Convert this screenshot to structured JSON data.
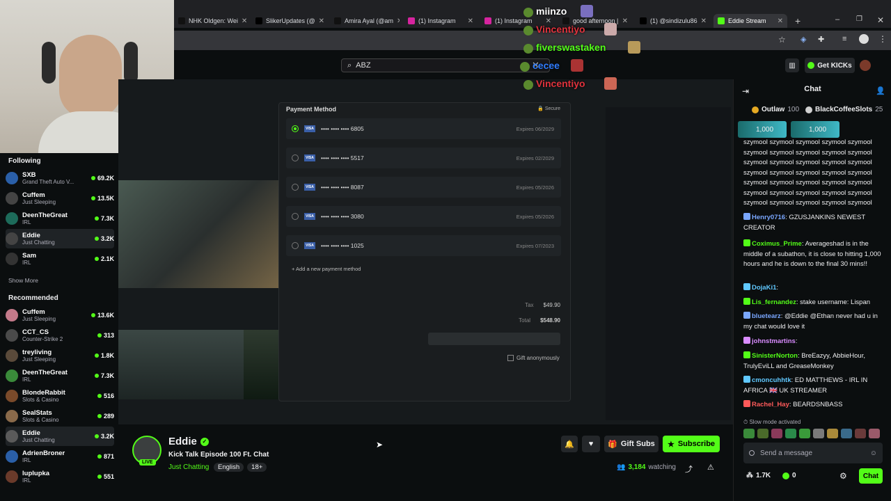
{
  "browser": {
    "tabs": [
      {
        "title": "NHK Oldgen: Wei",
        "icon": "tiktok-icon"
      },
      {
        "title": "SlikerUpdates (@",
        "icon": "x-icon"
      },
      {
        "title": "Amira Ayal (@am",
        "icon": "tiktok-icon"
      },
      {
        "title": "(1) Instagram",
        "icon": "instagram-icon"
      },
      {
        "title": "(1) Instagram",
        "icon": "instagram-icon"
      },
      {
        "title": "good afternoon |",
        "icon": "tiktok-icon"
      },
      {
        "title": "(1) @sindizulu86",
        "icon": "x-icon"
      },
      {
        "title": "Eddie Stream",
        "icon": "kick-icon"
      }
    ]
  },
  "site": {
    "search_value": "ABZ",
    "get_kicks": "Get KICKs"
  },
  "overlay_chat": [
    {
      "name": "miinzo",
      "color": "#ffffff"
    },
    {
      "name": "Vincentiyo",
      "color": "#e0323c"
    },
    {
      "name": "fiverswastaken",
      "color": "#53fc18"
    },
    {
      "name": "cecee",
      "color": "#2f7cff"
    },
    {
      "name": "Vincentiyo",
      "color": "#e0323c"
    }
  ],
  "sidebar": {
    "following_title": "Following",
    "following": [
      {
        "name": "SXB",
        "category": "Grand Theft Auto V...",
        "viewers": "69.2K"
      },
      {
        "name": "Cuffem",
        "category": "Just Sleeping",
        "viewers": "13.5K"
      },
      {
        "name": "DeenTheGreat",
        "category": "IRL",
        "viewers": "7.3K"
      },
      {
        "name": "Eddie",
        "category": "Just Chatting",
        "viewers": "3.2K"
      },
      {
        "name": "Sam",
        "category": "IRL",
        "viewers": "2.1K"
      }
    ],
    "show_more": "Show More",
    "recommended_title": "Recommended",
    "recommended": [
      {
        "name": "Cuffem",
        "category": "Just Sleeping",
        "viewers": "13.6K"
      },
      {
        "name": "CCT_CS",
        "category": "Counter-Strike 2",
        "viewers": "313"
      },
      {
        "name": "treyliving",
        "category": "Just Sleeping",
        "viewers": "1.8K"
      },
      {
        "name": "DeenTheGreat",
        "category": "IRL",
        "viewers": "7.3K"
      },
      {
        "name": "BlondeRabbit",
        "category": "Slots & Casino",
        "viewers": "516"
      },
      {
        "name": "SealStats",
        "category": "Slots & Casino",
        "viewers": "289"
      },
      {
        "name": "Eddie",
        "category": "Just Chatting",
        "viewers": "3.2K"
      },
      {
        "name": "AdrienBroner",
        "category": "IRL",
        "viewers": "871"
      },
      {
        "name": "luplupka",
        "category": "IRL",
        "viewers": "551"
      }
    ]
  },
  "payment": {
    "title": "Payment Method",
    "secure": "Secure",
    "cards": [
      {
        "mask": "•••• •••• •••• 6805",
        "expires": "Expires  06/2029",
        "selected": true
      },
      {
        "mask": "•••• •••• •••• 5517",
        "expires": "Expires  02/2029",
        "selected": false
      },
      {
        "mask": "•••• •••• •••• 8087",
        "expires": "Expires  05/2026",
        "selected": false
      },
      {
        "mask": "•••• •••• •••• 3080",
        "expires": "Expires  05/2026",
        "selected": false
      },
      {
        "mask": "•••• •••• •••• 1025",
        "expires": "Expires  07/2023",
        "selected": false
      }
    ],
    "add_new": "+ Add a new payment method",
    "tax_label": "Tax",
    "tax_value": "$49.90",
    "total_label": "Total",
    "total_value": "$548.90",
    "gift_anon": "Gift anonymously"
  },
  "stream": {
    "streamer": "Eddie",
    "title": "Kick Talk Episode 100 Ft. Chat",
    "category": "Just Chatting",
    "tags": [
      "English",
      "18+"
    ],
    "live_label": "LIVE",
    "viewers": "3,184",
    "watching_label": "watching",
    "gift_subs": "Gift Subs",
    "subscribe": "Subscribe"
  },
  "chat": {
    "title": "Chat",
    "leaderboard": [
      {
        "name": "Outlaw",
        "value": "100"
      },
      {
        "name": "BlackCoffeeSlots",
        "value": "25"
      }
    ],
    "pinned": [
      {
        "value": "1,000"
      },
      {
        "value": "1,000"
      }
    ],
    "spam_text": "szymool szymool szymool szymool szymool szymool szymool szymool szymool szymool szymool szymool szymool szymool szymool szymool szymool szymool szymool szymool szymool szymool szymool szymool szymool szymool szymool szymool szymool szymool szymool szymool szymool szymool szymool",
    "messages": [
      {
        "user": "Henry0716",
        "color": "#7aa7ff",
        "text": "GZUSJANKINS NEWEST CREATOR"
      },
      {
        "user": "Coximus_Prime",
        "color": "#53fc18",
        "text": "Averageshad is in the middle of a subathon, it is close to hitting 1,000 hours and he is down to the final 30 mins!!"
      },
      {
        "user": "DojaKi1",
        "color": "#60c8ff",
        "text": ""
      },
      {
        "user": "Lis_fernandez",
        "color": "#53fc18",
        "text": "stake username: Lispan"
      },
      {
        "user": "bluetearz",
        "color": "#7aa7ff",
        "text": "@Eddie @Ethan never had u in my chat would love it"
      },
      {
        "user": "johnstmartins",
        "color": "#d98cff",
        "text": ""
      },
      {
        "user": "SinisterNorton",
        "color": "#53fc18",
        "text": "BreEazyy, AbbieHour, TrulyEviLL and GreaseMonkey"
      },
      {
        "user": "cmoncuhhtk",
        "color": "#60c8ff",
        "text": "ED MATTHEWS - IRL IN AFRICA 🇬🇧 UK STREAMER"
      },
      {
        "user": "Rachel_Hay",
        "color": "#ff5a5a",
        "text": "BEARDSNBASS"
      }
    ],
    "slow_mode": "Slow mode activated",
    "input_placeholder": "Send a message",
    "points": "1.7K",
    "kicks": "0",
    "chat_button": "Chat"
  }
}
